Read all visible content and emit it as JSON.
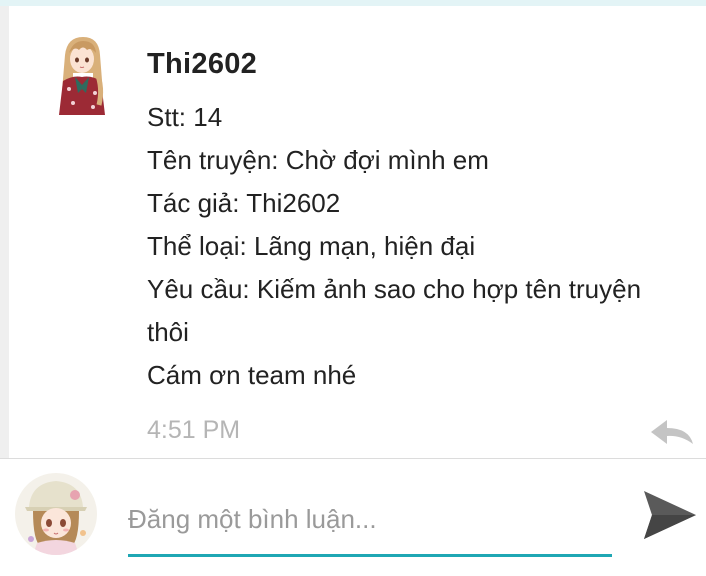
{
  "comment": {
    "author": "Thi2602",
    "lines": [
      "Stt: 14",
      "Tên truyện: Chờ đợi mình em",
      "Tác giả: Thi2602",
      "Thể loại: Lãng mạn, hiện đại",
      "Yêu cầu: Kiếm ảnh sao cho hợp tên truyện",
      "thôi",
      "Cám ơn team nhé"
    ],
    "time": "4:51 PM",
    "avatar_icon": "anime-girl-avatar-icon",
    "reply_icon": "reply-icon"
  },
  "composer": {
    "placeholder": "Đăng một bình luận...",
    "value": "",
    "avatar_icon": "anime-girl-avatar-icon",
    "send_icon": "send-icon"
  },
  "colors": {
    "accent": "#1fa7b4",
    "top_strip": "#e3f4f6",
    "text": "#222222",
    "muted": "#b5b5b5",
    "placeholder": "#9a9a9a"
  }
}
